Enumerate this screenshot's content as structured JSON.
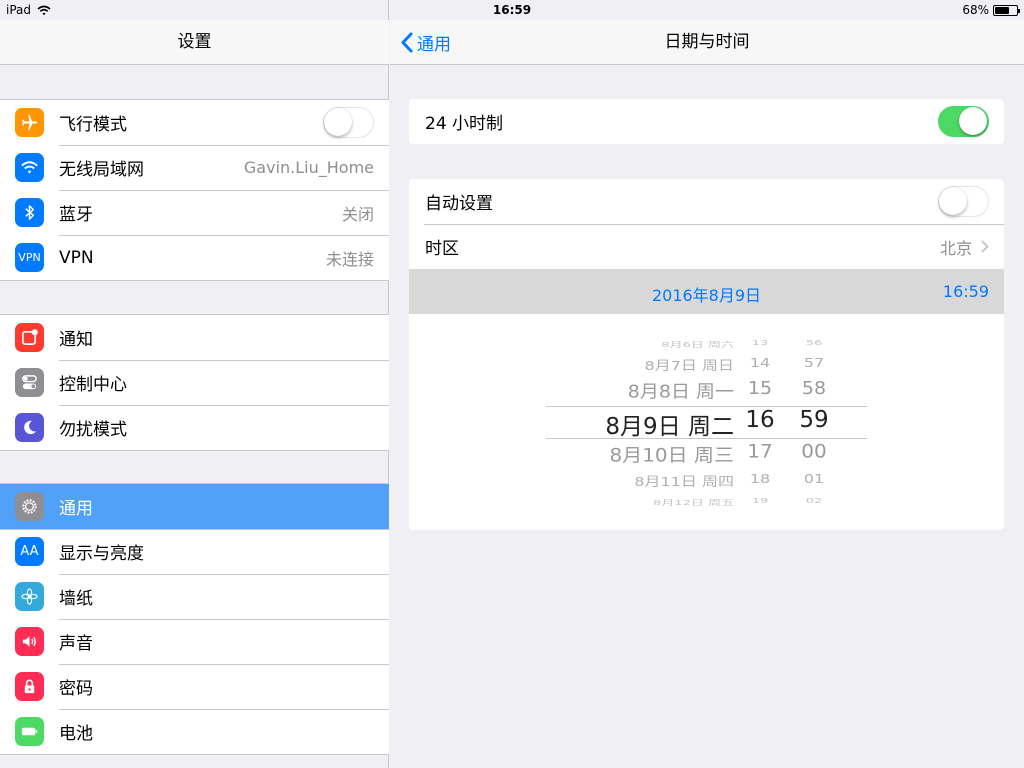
{
  "status_bar": {
    "device": "iPad",
    "time": "16:59",
    "battery": "68%",
    "battery_level": 0.68
  },
  "sidebar": {
    "title": "设置",
    "groups": [
      [
        {
          "label": "飞行模式",
          "icon": "airplane-icon",
          "color": "#ff9500",
          "toggle": false
        },
        {
          "label": "无线局域网",
          "icon": "wifi-icon",
          "color": "#007aff",
          "value": "Gavin.Liu_Home"
        },
        {
          "label": "蓝牙",
          "icon": "bluetooth-icon",
          "color": "#007aff",
          "value": "关闭"
        },
        {
          "label": "VPN",
          "icon": "vpn-icon",
          "icon_text": "VPN",
          "color": "#007aff",
          "value": "未连接"
        }
      ],
      [
        {
          "label": "通知",
          "icon": "notifications-icon",
          "color": "#ff3b30"
        },
        {
          "label": "控制中心",
          "icon": "control-center-icon",
          "color": "#8e8e93"
        },
        {
          "label": "勿扰模式",
          "icon": "moon-icon",
          "color": "#5856d6"
        }
      ],
      [
        {
          "label": "通用",
          "icon": "gear-icon",
          "color": "#8e8e93",
          "selected": true
        },
        {
          "label": "显示与亮度",
          "icon": "display-brightness-icon",
          "icon_text": "AA",
          "color": "#007aff"
        },
        {
          "label": "墙纸",
          "icon": "wallpaper-icon",
          "color": "#34aadc"
        },
        {
          "label": "声音",
          "icon": "speaker-icon",
          "color": "#ff2d55"
        },
        {
          "label": "密码",
          "icon": "lock-icon",
          "color": "#ff2d55"
        },
        {
          "label": "电池",
          "icon": "battery-icon",
          "color": "#4cd964"
        }
      ]
    ]
  },
  "detail": {
    "back_label": "通用",
    "title": "日期与时间",
    "hour24": {
      "label": "24 小时制",
      "on": true
    },
    "auto": {
      "label": "自动设置",
      "on": false
    },
    "timezone": {
      "label": "时区",
      "value": "北京"
    },
    "selected_date": "2016年8月9日",
    "selected_time": "16:59",
    "picker_rows": [
      {
        "date": "8月6日 周六",
        "hour": "13",
        "minute": "56"
      },
      {
        "date": "8月7日 周日",
        "hour": "14",
        "minute": "57"
      },
      {
        "date": "8月8日 周一",
        "hour": "15",
        "minute": "58"
      },
      {
        "date": "8月9日 周二",
        "hour": "16",
        "minute": "59"
      },
      {
        "date": "8月10日 周三",
        "hour": "17",
        "minute": "00"
      },
      {
        "date": "8月11日 周四",
        "hour": "18",
        "minute": "01"
      },
      {
        "date": "8月12日 周五",
        "hour": "19",
        "minute": "02"
      }
    ]
  }
}
